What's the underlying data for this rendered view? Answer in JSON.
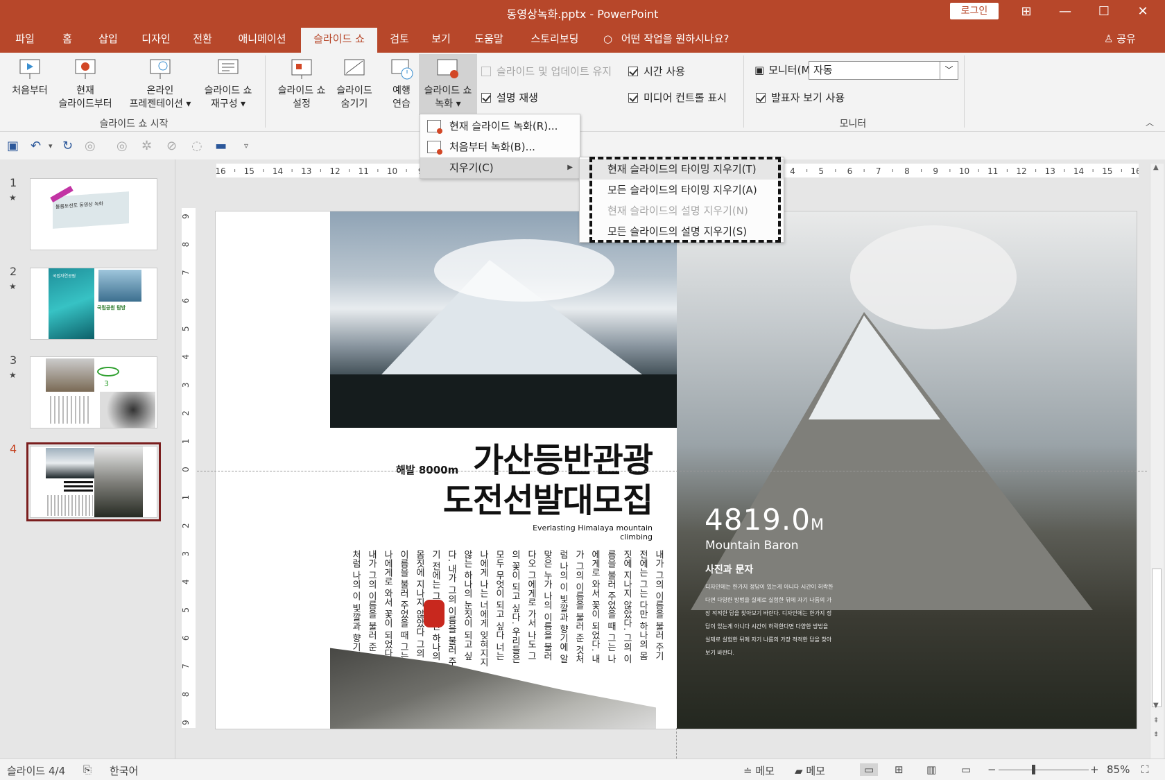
{
  "window": {
    "title": "동영상녹화.pptx  -  PowerPoint",
    "login": "로그인",
    "minimize": "—",
    "maximize": "☐",
    "close": "✕",
    "restore_icon": "⊞"
  },
  "tabs": [
    {
      "label": "파일"
    },
    {
      "label": "홈"
    },
    {
      "label": "삽입"
    },
    {
      "label": "디자인"
    },
    {
      "label": "전환"
    },
    {
      "label": "애니메이션"
    },
    {
      "label": "슬라이드 쇼"
    },
    {
      "label": "검토"
    },
    {
      "label": "보기"
    },
    {
      "label": "도움말"
    },
    {
      "label": "스토리보딩"
    }
  ],
  "tell_me": "어떤 작업을 원하시나요?",
  "share": "공유",
  "ribbon": {
    "start_group": {
      "from_beginning": [
        "처음부터",
        ""
      ],
      "from_current": [
        "현재",
        "슬라이드부터"
      ],
      "online": [
        "온라인",
        "프레젠테이션 ▾"
      ],
      "custom": [
        "슬라이드 쇼",
        "재구성 ▾"
      ],
      "label": "슬라이드 쇼 시작"
    },
    "setup_group": {
      "setup": [
        "슬라이드 쇼",
        "설정"
      ],
      "hide": [
        "슬라이드",
        "숨기기"
      ],
      "rehearse": [
        "예행",
        "연습"
      ],
      "record": [
        "슬라이드 쇼",
        "녹화 ▾"
      ],
      "keep_updated": "슬라이드 및 업데이트 유지",
      "play_narration": "설명 재생",
      "use_timings": "시간 사용",
      "show_media": "미디어 컨트롤 표시"
    },
    "monitor_group": {
      "monitor_label": "모니터(M):",
      "monitor_value": "자동",
      "presenter_view": "발표자 보기 사용",
      "label": "모니터"
    }
  },
  "record_menu": {
    "items": [
      {
        "label": "현재 슬라이드 녹화(R)..."
      },
      {
        "label": "처음부터 녹화(B)..."
      },
      {
        "label": "지우기(C)"
      }
    ],
    "submenu": [
      {
        "label": "현재 슬라이드의 타이밍 지우기(T)"
      },
      {
        "label": "모든 슬라이드의 타이밍 지우기(A)"
      },
      {
        "label": "현재 슬라이드의 설명 지우기(N)"
      },
      {
        "label": "모든 슬라이드의 설명 지우기(S)"
      }
    ]
  },
  "thumbnails": [
    {
      "num": "1",
      "star": "★"
    },
    {
      "num": "2",
      "star": "★"
    },
    {
      "num": "3",
      "star": "★"
    },
    {
      "num": "4",
      "star": ""
    }
  ],
  "thumb_texts": {
    "t1_banner": "볼륨도전도 동영상 녹화",
    "t2_title": "국립공원 탐방",
    "t2_sub": "국립자연공원",
    "t3_note": "3"
  },
  "ruler_h": [
    "16",
    "15",
    "14",
    "13",
    "12",
    "11",
    "10",
    "9",
    "8",
    "7",
    "6",
    "5",
    "4",
    "3",
    "2",
    "1",
    "0",
    "1",
    "2",
    "3",
    "4",
    "5",
    "6",
    "7",
    "8",
    "9",
    "10",
    "11",
    "12",
    "13",
    "14",
    "15",
    "16"
  ],
  "ruler_v": [
    "9",
    "8",
    "7",
    "6",
    "5",
    "4",
    "3",
    "2",
    "1",
    "0",
    "1",
    "2",
    "3",
    "4",
    "5",
    "6",
    "7",
    "8",
    "9"
  ],
  "slide": {
    "altitude": "해발 8000m",
    "headline_1": "가산등반관광",
    "headline_2": "도전선발대모집",
    "subline": "Everlasting Himalaya mountain climbing",
    "vertical_text": "내가 그의 이름을 불러 주기 전에는 그는 다만 하나의 몸짓에 지나지 않았다. 그의 이름을 불러 주었을 때 그는 나에게로 와서 꽃이 되었다. 내가 그의 이름을 불러 준 것처럼 나의 이 빛깔과 향기에 알맞은 누가 나의 이름을 불러다오 그에게로 가서 나도 그의 꽃이 되고 싶다. 우리들은 모두 무엇이 되고 싶다 너는 나에게 나는 너에게 잊혀지지 않는 하나의 눈짓이 되고 싶다. 내가 그의 이름을 불러 주기 전에는 그는 다만 하나의 몸짓에 지나지 않았다 그의 이름을 불러 주었을 때 그는 나에게로 와서 꽃이 되었다. 내가 그의 이름을 불러 준 것처럼 나의 이 빛깔과 향기에 알맞은 누가 나의 이름을 불러다오 그에게로 가서 나도 그의 꽃이 되고 싶다. 우리들은 모두 무엇이 되고 싶다 너는 나에게 나는 너에게 잊혀지지 않는 하나의 눈짓이 되고 싶다.",
    "height_value": "4819.0",
    "height_unit": "M",
    "baron": "Mountain Baron",
    "photo_title": "사진과 문자",
    "photo_body": "디자인에는 한가지 정답이 있는게 아니다 시간이 허락한다면 다양한 방법을 실제로 실험한 뒤에 자기 나름의 가장 적적한 답을 찾아보기 바란다. 디자인에는 한가지 정답이 있는게 아니다 시간이 허락한다면 다양한 방법을 실제로 실험한 뒤에 자기 나름의 가장 적적한 답을 찾아보기 바란다."
  },
  "status": {
    "slide_info": "슬라이드 4/4",
    "language": "한국어",
    "notes": "메모",
    "comments": "메모",
    "zoom": "85%"
  }
}
